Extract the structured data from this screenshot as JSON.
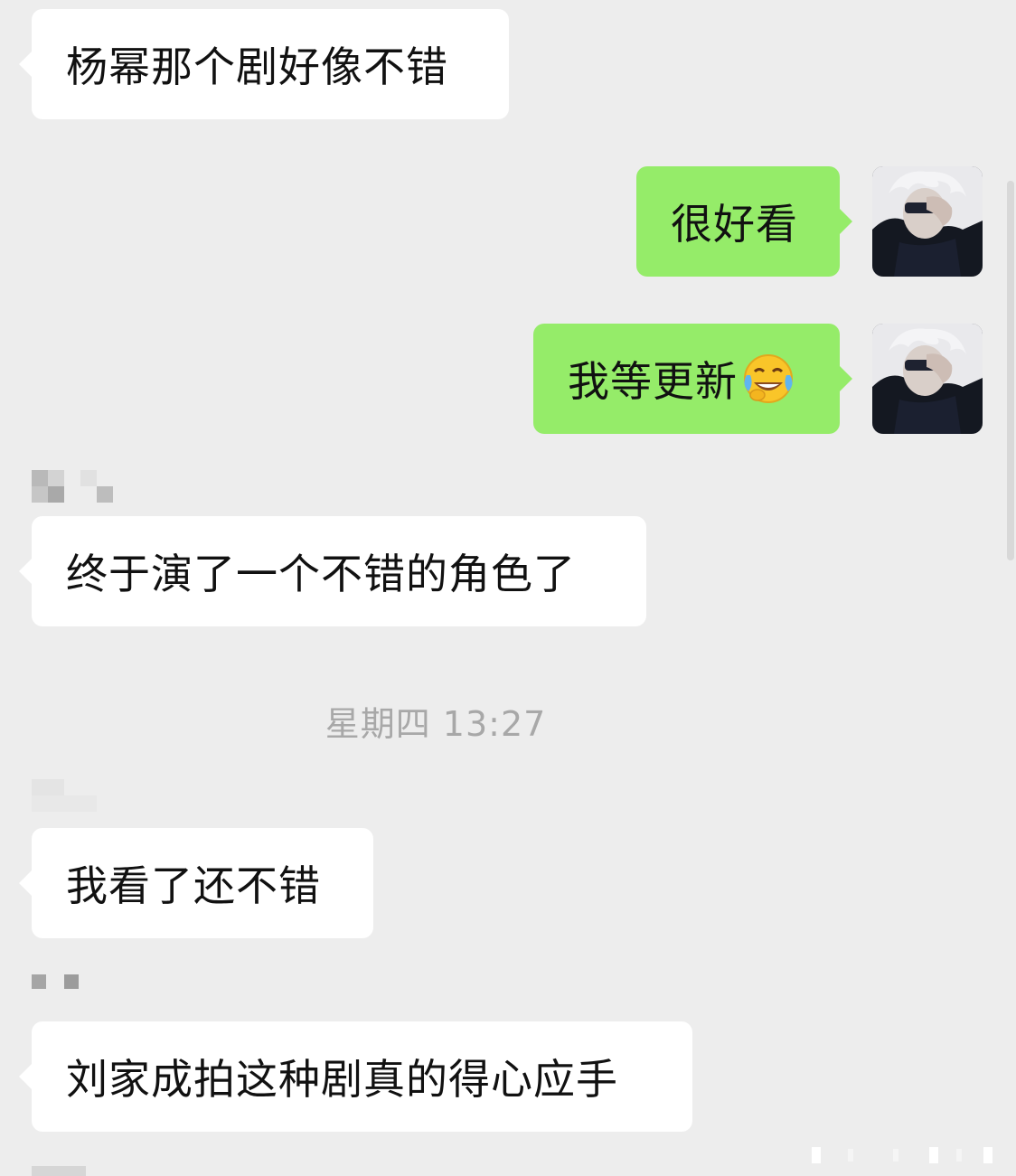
{
  "messages": [
    {
      "text": "杨幂那个剧好像不错",
      "direction": "incoming"
    },
    {
      "text": "很好看",
      "direction": "outgoing"
    },
    {
      "text": "我等更新",
      "emoji": "face-with-tears-of-joy-icon",
      "direction": "outgoing"
    },
    {
      "text": "终于演了一个不错的角色了",
      "direction": "incoming"
    },
    {
      "text": "我看了还不错",
      "direction": "incoming"
    },
    {
      "text": "刘家成拍这种剧真的得心应手",
      "direction": "incoming"
    }
  ],
  "timestamp": "星期四 13:27",
  "colors": {
    "background": "#ededed",
    "incoming_bubble": "#ffffff",
    "outgoing_bubble": "#95ec69",
    "timestamp_text": "#a8a8a8"
  }
}
